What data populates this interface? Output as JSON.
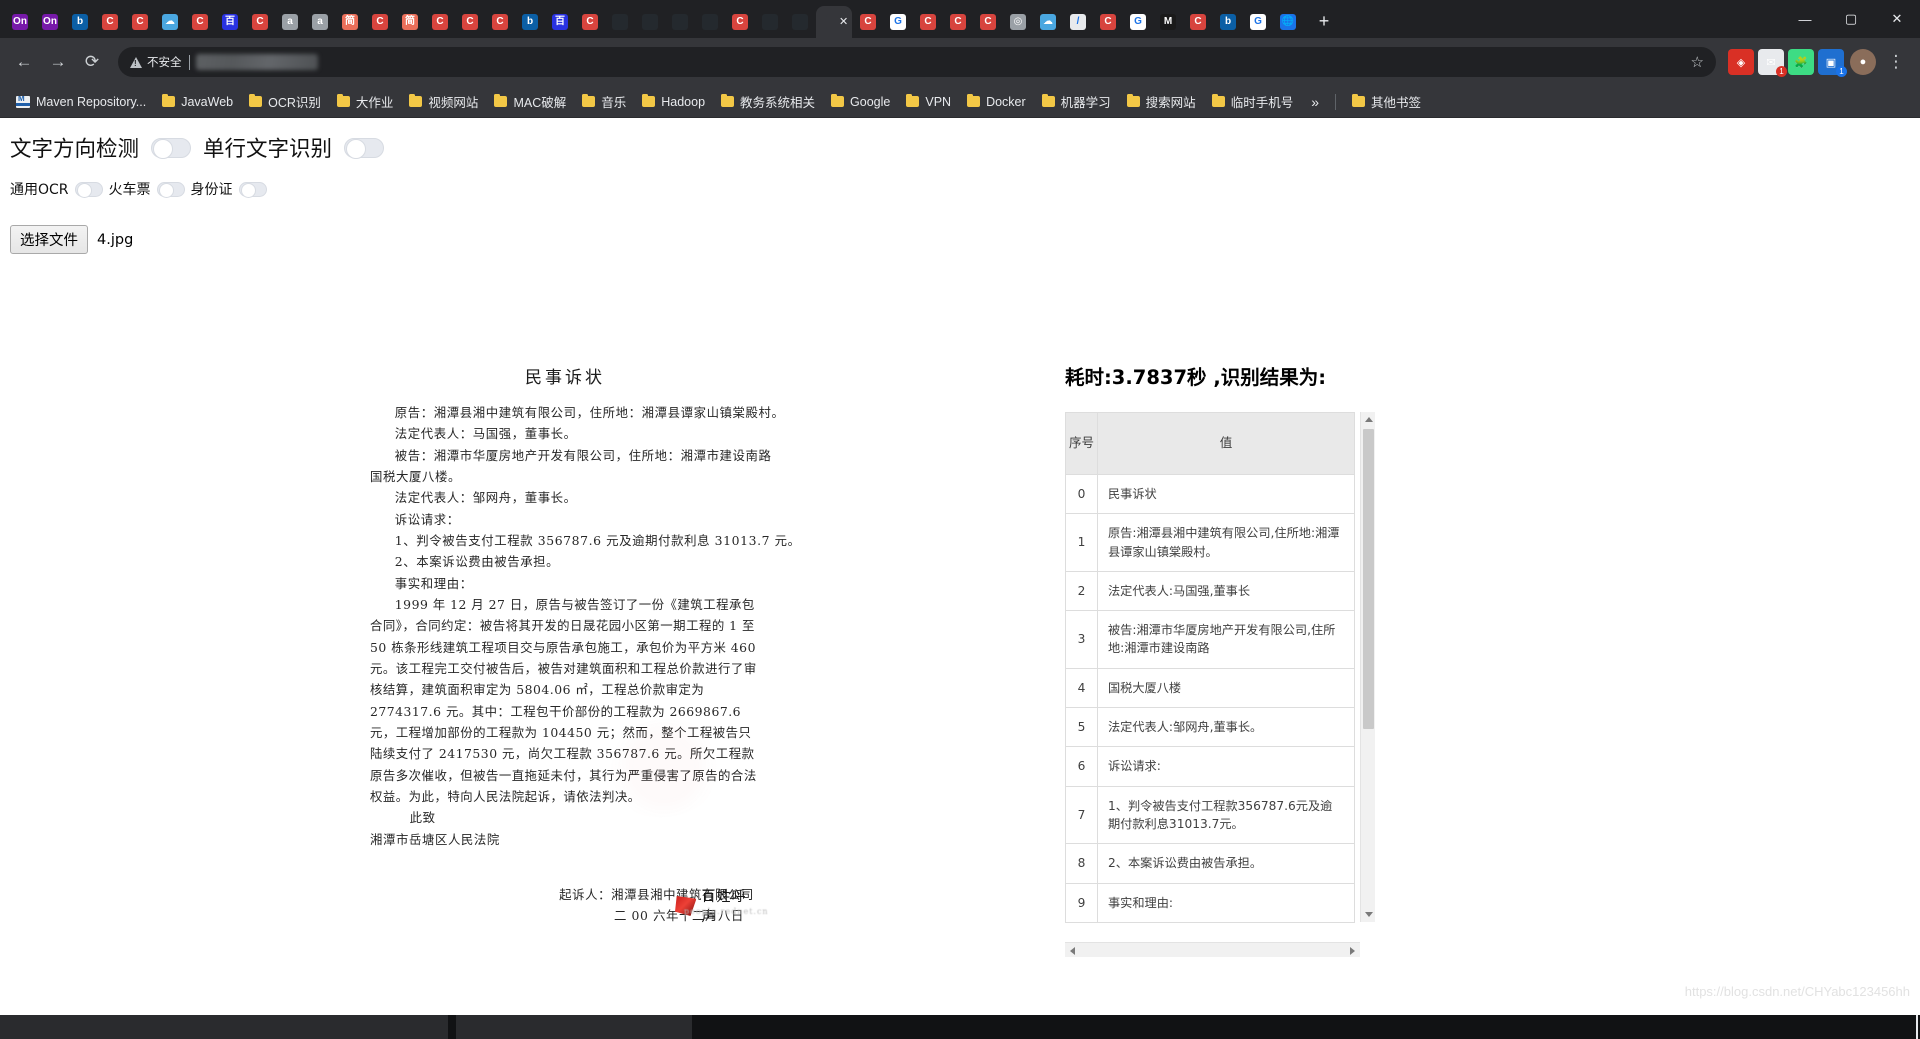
{
  "browser": {
    "tabs": [
      {
        "name": "onenote-tab-1",
        "letter": "On",
        "bg": "#7719aa",
        "active": false
      },
      {
        "name": "onenote-tab-2",
        "letter": "On",
        "bg": "#7719aa",
        "active": false
      },
      {
        "name": "bing-tab",
        "letter": "b",
        "bg": "#0b5fa5",
        "active": false
      },
      {
        "name": "csdn-tab-1",
        "letter": "C",
        "bg": "#d7443e",
        "active": false
      },
      {
        "name": "csdn-tab-2",
        "letter": "C",
        "bg": "#d7443e",
        "active": false
      },
      {
        "name": "cloud-tab",
        "letter": "☁",
        "bg": "#4aa7e0",
        "active": false
      },
      {
        "name": "csdn-tab-3",
        "letter": "C",
        "bg": "#d7443e",
        "active": false
      },
      {
        "name": "baidu-tab",
        "letter": "百",
        "bg": "#2932e1",
        "active": false
      },
      {
        "name": "csdn-tab-4",
        "letter": "C",
        "bg": "#d7443e",
        "active": false
      },
      {
        "name": "doc-tab-1",
        "letter": "a",
        "bg": "#9aa0a6",
        "active": false
      },
      {
        "name": "doc-tab-2",
        "letter": "a",
        "bg": "#9aa0a6",
        "active": false
      },
      {
        "name": "jianshu-tab-1",
        "letter": "简",
        "bg": "#ea6f5a",
        "active": false
      },
      {
        "name": "csdn-tab-5",
        "letter": "C",
        "bg": "#d7443e",
        "active": false
      },
      {
        "name": "jianshu-tab-2",
        "letter": "简",
        "bg": "#ea6f5a",
        "active": false
      },
      {
        "name": "csdn-tab-6",
        "letter": "C",
        "bg": "#d7443e",
        "active": false
      },
      {
        "name": "csdn-tab-7",
        "letter": "C",
        "bg": "#d7443e",
        "active": false
      },
      {
        "name": "csdn-tab-8",
        "letter": "C",
        "bg": "#d7443e",
        "active": false
      },
      {
        "name": "bing-tab-2",
        "letter": "b",
        "bg": "#0b5fa5",
        "active": false
      },
      {
        "name": "baidu-tab-2",
        "letter": "百",
        "bg": "#2932e1",
        "active": false
      },
      {
        "name": "csdn-tab-9",
        "letter": "C",
        "bg": "#d7443e",
        "active": false
      },
      {
        "name": "github-tab-1",
        "letter": "",
        "bg": "#24292e",
        "active": false
      },
      {
        "name": "github-tab-2",
        "letter": "",
        "bg": "#24292e",
        "active": false
      },
      {
        "name": "github-tab-3",
        "letter": "",
        "bg": "#24292e",
        "active": false
      },
      {
        "name": "github-tab-4",
        "letter": "",
        "bg": "#24292e",
        "active": false
      },
      {
        "name": "csdn-tab-10",
        "letter": "C",
        "bg": "#d7443e",
        "active": false
      },
      {
        "name": "github-tab-5",
        "letter": "",
        "bg": "#24292e",
        "active": false
      },
      {
        "name": "github-tab-6",
        "letter": "",
        "bg": "#24292e",
        "active": false
      },
      {
        "name": "active-ocr-tab",
        "letter": "",
        "bg": "#35363a",
        "active": true
      },
      {
        "name": "csdn-tab-11",
        "letter": "C",
        "bg": "#d7443e",
        "active": false
      },
      {
        "name": "google-tab-1",
        "letter": "G",
        "bg": "#ffffff",
        "active": false
      },
      {
        "name": "csdn-tab-12",
        "letter": "C",
        "bg": "#d7443e",
        "active": false
      },
      {
        "name": "csdn-tab-13",
        "letter": "C",
        "bg": "#d7443e",
        "active": false
      },
      {
        "name": "csdn-tab-14",
        "letter": "C",
        "bg": "#d7443e",
        "active": false
      },
      {
        "name": "gray-tab",
        "letter": "◎",
        "bg": "#9aa0a6",
        "active": false
      },
      {
        "name": "cloud-tab-2",
        "letter": "☁",
        "bg": "#4aa7e0",
        "active": false
      },
      {
        "name": "editor-tab",
        "letter": "/",
        "bg": "#e8eaed",
        "active": false
      },
      {
        "name": "csdn-tab-15",
        "letter": "C",
        "bg": "#d7443e",
        "active": false
      },
      {
        "name": "google-tab-2",
        "letter": "G",
        "bg": "#ffffff",
        "active": false
      },
      {
        "name": "medium-tab",
        "letter": "M",
        "bg": "#1a1a1a",
        "active": false
      },
      {
        "name": "csdn-tab-16",
        "letter": "C",
        "bg": "#d7443e",
        "active": false
      },
      {
        "name": "bing-tab-3",
        "letter": "b",
        "bg": "#0b5fa5",
        "active": false
      },
      {
        "name": "google-tab-3",
        "letter": "G",
        "bg": "#ffffff",
        "active": false
      },
      {
        "name": "globe-tab",
        "letter": "🌐",
        "bg": "#1a73e8",
        "active": false
      }
    ],
    "new_tab_label": "+",
    "window_controls": {
      "minimize": "—",
      "maximize": "▢",
      "close": "✕"
    },
    "nav": {
      "back": "←",
      "forward": "→",
      "reload": "⟳",
      "star": "☆",
      "menu": "⋮"
    },
    "omnibox": {
      "security_label": "不安全",
      "url_value": ""
    },
    "extensions": [
      {
        "name": "extension-red",
        "glyph": "◈",
        "bg": "#d93025",
        "badge": ""
      },
      {
        "name": "extension-mail",
        "glyph": "✉",
        "bg": "#e8eaed",
        "badge": "1"
      },
      {
        "name": "extension-puzzle",
        "glyph": "🧩",
        "bg": "#3ddc84",
        "badge": ""
      },
      {
        "name": "extension-blue",
        "glyph": "▣",
        "bg": "#1f6fd0",
        "badge": "1"
      }
    ],
    "bookmarks": [
      {
        "label": "Maven Repository...",
        "icon": "maven-icon"
      },
      {
        "label": "JavaWeb",
        "icon": "folder-icon"
      },
      {
        "label": "OCR识别",
        "icon": "folder-icon"
      },
      {
        "label": "大作业",
        "icon": "folder-icon"
      },
      {
        "label": "视频网站",
        "icon": "folder-icon"
      },
      {
        "label": "MAC破解",
        "icon": "folder-icon"
      },
      {
        "label": "音乐",
        "icon": "folder-icon"
      },
      {
        "label": "Hadoop",
        "icon": "folder-icon"
      },
      {
        "label": "教务系统相关",
        "icon": "folder-icon"
      },
      {
        "label": "Google",
        "icon": "folder-icon"
      },
      {
        "label": "VPN",
        "icon": "folder-icon"
      },
      {
        "label": "Docker",
        "icon": "folder-icon"
      },
      {
        "label": "机器学习",
        "icon": "folder-icon"
      },
      {
        "label": "搜索网站",
        "icon": "folder-icon"
      },
      {
        "label": "临时手机号",
        "icon": "folder-icon"
      }
    ],
    "bookmarks_overflow": "»",
    "other_bookmarks": "其他书签"
  },
  "controls": {
    "direction_detect_label": "文字方向检测",
    "single_line_label": "单行文字识别",
    "general_ocr_label": "通用OCR",
    "train_ticket_label": "火车票",
    "id_card_label": "身份证",
    "toggles_state": "off"
  },
  "file_upload": {
    "button_label": "选择文件",
    "file_name": "4.jpg"
  },
  "document": {
    "title": "民事诉状",
    "lines": [
      "原告：湘潭县湘中建筑有限公司，住所地：湘潭县谭家山镇棠殿村。",
      "法定代表人：马国强，董事长。",
      "被告：湘潭市华厦房地产开发有限公司，住所地：湘潭市建设南路",
      "国税大厦八楼。",
      "法定代表人：邹网舟，董事长。",
      "诉讼请求：",
      "1、判令被告支付工程款 356787.6 元及逾期付款利息 31013.7 元。",
      "2、本案诉讼费由被告承担。",
      "事实和理由：",
      "1999 年 12 月 27 日，原告与被告签订了一份《建筑工程承包合同》，合同约定：被告将其开发的日晟花园小区第一期工程的 1 至 50 栋条形线建筑工程项目交与原告承包施工，承包价为平方米 460 元。该工程完工交付被告后，被告对建筑面积和工程总价款进行了审核结算，建筑面积审定为 5804.06 ㎡，工程总价款审定为 2774317.6 元。其中：工程包干价部份的工程款为 2669867.6 元，工程增加部份的工程款为 104450 元；然而，整个工程被告只陆续支付了 2417530 元，尚欠工程款 356787.6 元。所欠工程款原告多次催收，但被告一直拖延未付，其行为严重侵害了原告的合法权益。为此，特向人民法院起诉，请依法判决。"
    ],
    "closing": "此致",
    "court": "湘潭市岳塘区人民法院",
    "signer": "起诉人：湘潭县湘中建筑有限公司",
    "date": "二 00 六年十二月八日",
    "watermark_logo": "百姓呼声",
    "watermark_sub": "people.rednet.cn"
  },
  "result": {
    "title": "耗时:3.7837秒 ,识别结果为:",
    "elapsed_seconds": "3.7837",
    "columns": [
      "序号",
      "值"
    ],
    "rows": [
      {
        "index": "0",
        "value": "民事诉状"
      },
      {
        "index": "1",
        "value": "原告:湘潭县湘中建筑有限公司,住所地:湘潭县谭家山镇棠殿村。"
      },
      {
        "index": "2",
        "value": "法定代表人:马国强,董事长"
      },
      {
        "index": "3",
        "value": "被告:湘潭市华厦房地产开发有限公司,住所地:湘潭市建设南路"
      },
      {
        "index": "4",
        "value": "国税大厦八楼"
      },
      {
        "index": "5",
        "value": "法定代表人:邹网舟,董事长。"
      },
      {
        "index": "6",
        "value": "诉讼请求:"
      },
      {
        "index": "7",
        "value": "1、判令被告支付工程款356787.6元及逾期付款利息31013.7元。"
      },
      {
        "index": "8",
        "value": "2、本案诉讼费由被告承担。"
      },
      {
        "index": "9",
        "value": "事实和理由:"
      }
    ]
  },
  "page_watermark": "https://blog.csdn.net/CHYabc123456hh"
}
